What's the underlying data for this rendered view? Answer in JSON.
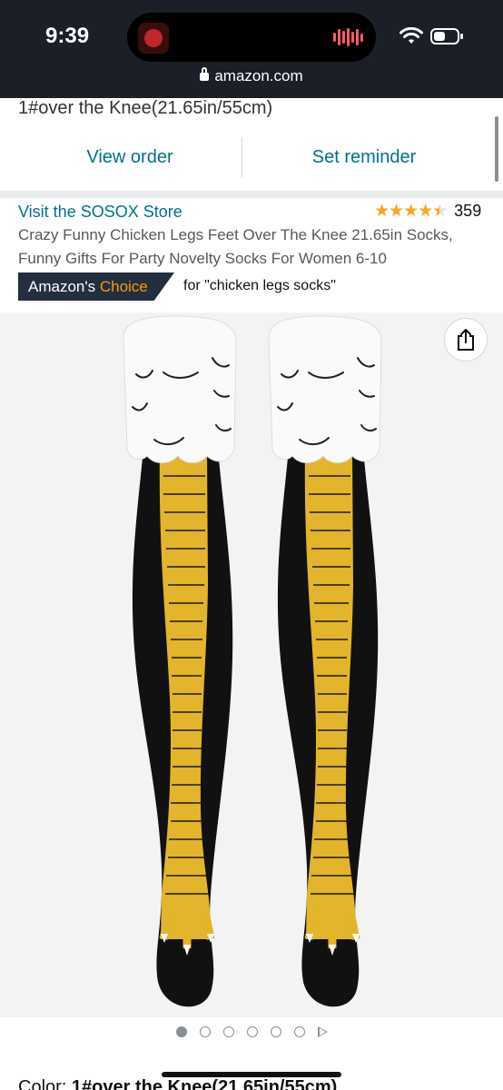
{
  "status_bar": {
    "time": "9:39"
  },
  "browser": {
    "domain": "amazon.com"
  },
  "order": {
    "variant_text": "1#over the Knee(21.65in/55cm)",
    "view_order_label": "View order",
    "set_reminder_label": "Set reminder"
  },
  "product": {
    "store_link": "Visit the SOSOX Store",
    "rating_value": 4.5,
    "rating_stars": "★★★★★",
    "rating_count": "359",
    "title": "Crazy Funny Chicken Legs Feet Over The Knee 21.65in Socks, Funny Gifts For Party Novelty Socks For Women 6-10",
    "badge_prefix": "Amazon's",
    "badge_accent": "Choice",
    "badge_for": "for \"chicken legs socks\""
  },
  "gallery": {
    "image_count": 6,
    "active_index": 0,
    "has_video": true
  },
  "variant": {
    "label": "Color:",
    "value": "1#over the Knee(21.65in/55cm)"
  },
  "colors": {
    "link": "#007185",
    "star": "#ffa41c",
    "badge_bg": "#232f3e",
    "badge_accent": "#ff9900",
    "sock_yellow": "#e3b52b",
    "sock_black": "#111111"
  },
  "icons": {
    "share": "share-icon",
    "lock": "lock-icon",
    "wifi": "wifi-icon",
    "battery": "battery-icon",
    "play": "play-icon"
  }
}
